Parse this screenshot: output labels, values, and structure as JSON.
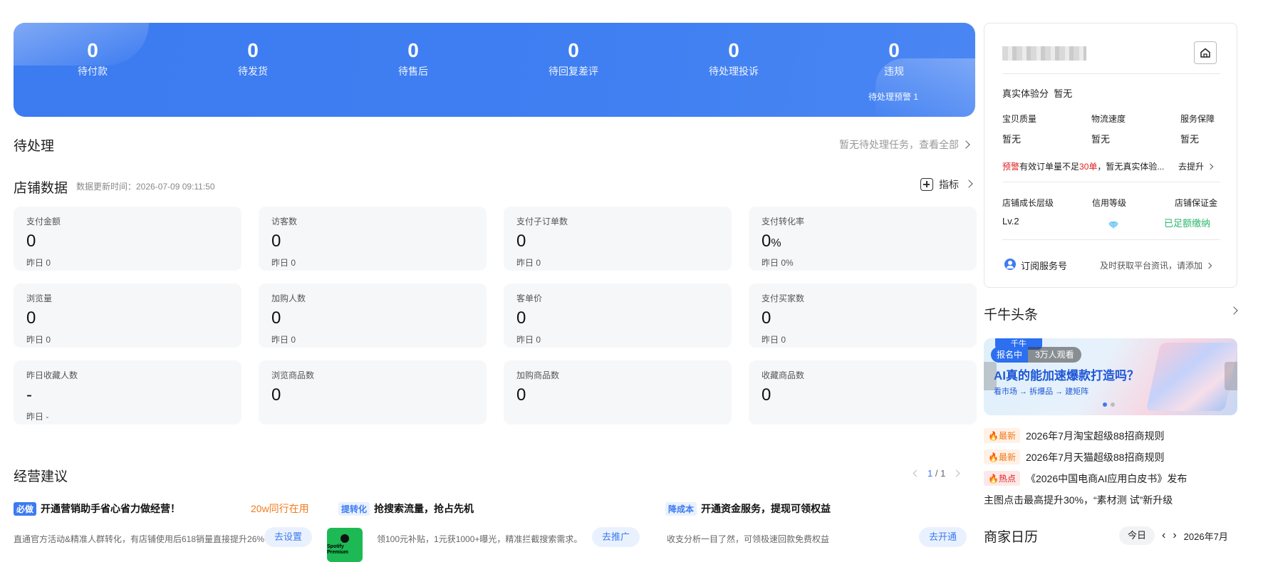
{
  "banner": {
    "stats": [
      {
        "num": "0",
        "label": "待付款"
      },
      {
        "num": "0",
        "label": "待发货"
      },
      {
        "num": "0",
        "label": "待售后"
      },
      {
        "num": "0",
        "label": "待回复差评"
      },
      {
        "num": "0",
        "label": "待处理投诉"
      },
      {
        "num": "0",
        "label": "违规"
      }
    ],
    "warning": "待处理预警 1"
  },
  "todo": {
    "title": "待处理",
    "link": "暂无待处理任务，查看全部"
  },
  "shop_data": {
    "title": "店铺数据",
    "update_time": "数据更新时间：2026-07-09 09:11:50",
    "metric_link": "指标",
    "cards": [
      {
        "title": "支付金额",
        "value": "0",
        "unit": "",
        "yesterday": "昨日 0"
      },
      {
        "title": "访客数",
        "value": "0",
        "unit": "",
        "yesterday": "昨日 0"
      },
      {
        "title": "支付子订单数",
        "value": "0",
        "unit": "",
        "yesterday": "昨日 0"
      },
      {
        "title": "支付转化率",
        "value": "0",
        "unit": "%",
        "yesterday": "昨日 0%"
      },
      {
        "title": "浏览量",
        "value": "0",
        "unit": "",
        "yesterday": "昨日 0"
      },
      {
        "title": "加购人数",
        "value": "0",
        "unit": "",
        "yesterday": "昨日 0"
      },
      {
        "title": "客单价",
        "value": "0",
        "unit": "",
        "yesterday": "昨日 0"
      },
      {
        "title": "支付买家数",
        "value": "0",
        "unit": "",
        "yesterday": "昨日 0"
      },
      {
        "title": "昨日收藏人数",
        "value": "-",
        "unit": "",
        "yesterday": "昨日 -"
      },
      {
        "title": "浏览商品数",
        "value": "0",
        "unit": "",
        "yesterday": ""
      },
      {
        "title": "加购商品数",
        "value": "0",
        "unit": "",
        "yesterday": ""
      },
      {
        "title": "收藏商品数",
        "value": "0",
        "unit": "",
        "yesterday": ""
      }
    ]
  },
  "suggestions": {
    "title": "经营建议",
    "page": "1",
    "page_total": "/ 1",
    "items": [
      {
        "tag": "必做",
        "headline": "开通营销助手省心省力做经营！",
        "extra": "20w同行在用",
        "desc": "直通官方活动&精准人群转化，有店铺使用后618销量直接提升26%",
        "button": "去设置"
      },
      {
        "tag": "提转化",
        "headline": "抢搜索流量，抢占先机",
        "extra": "",
        "desc": "领100元补贴，1元获1000+曝光，精准拦截搜索需求。",
        "button": "去推广",
        "image_text": "Spotify Premium"
      },
      {
        "tag": "降成本",
        "headline": "开通资金服务，提现可领权益",
        "extra": "",
        "desc": "收支分析一目了然，可领极速回款免费权益",
        "button": "去开通"
      }
    ],
    "tag_colors": {
      "must": "#3c7bf0",
      "soft_bg": "#eaf1fe"
    }
  },
  "shop_panel": {
    "experience_label": "真实体验分",
    "experience_value": "暂无",
    "scores": [
      {
        "label": "宝贝质量",
        "value": "暂无"
      },
      {
        "label": "物流速度",
        "value": "暂无"
      },
      {
        "label": "服务保障",
        "value": "暂无"
      }
    ],
    "alert_tag": "预警",
    "alert_text_a": "有效订单量不足",
    "alert_num": "30单",
    "alert_text_b": "，暂无真实体验...",
    "alert_link": "去提升",
    "growth_label": "店铺成长层级",
    "growth_value": "Lv.2",
    "credit_label": "信用等级",
    "deposit_label": "店铺保证金",
    "deposit_value": "已足额缴纳",
    "subscribe_label": "订阅服务号",
    "subscribe_desc": "及时获取平台资讯，请添加"
  },
  "news": {
    "title": "千牛头条",
    "slide": {
      "logo": "千牛",
      "badge_live": "报名中",
      "badge_viewers": "3万人观看",
      "headline": "AI真的能加速爆款打造吗？",
      "sub": "看市场 → 拆爆品 → 建矩阵"
    },
    "items": [
      {
        "tag": "最新",
        "kind": "new",
        "text": "2026年7月淘宝超级88招商规则"
      },
      {
        "tag": "最新",
        "kind": "new",
        "text": "2026年7月天猫超级88招商规则"
      },
      {
        "tag": "热点",
        "kind": "hot",
        "text": "《2026中国电商AI应用白皮书》发布"
      },
      {
        "tag": "",
        "kind": "",
        "text": "主图点击最高提升30%，“素材测 试”新升级"
      }
    ]
  },
  "calendar": {
    "title": "商家日历",
    "today": "今日",
    "month": "2026年7月"
  }
}
